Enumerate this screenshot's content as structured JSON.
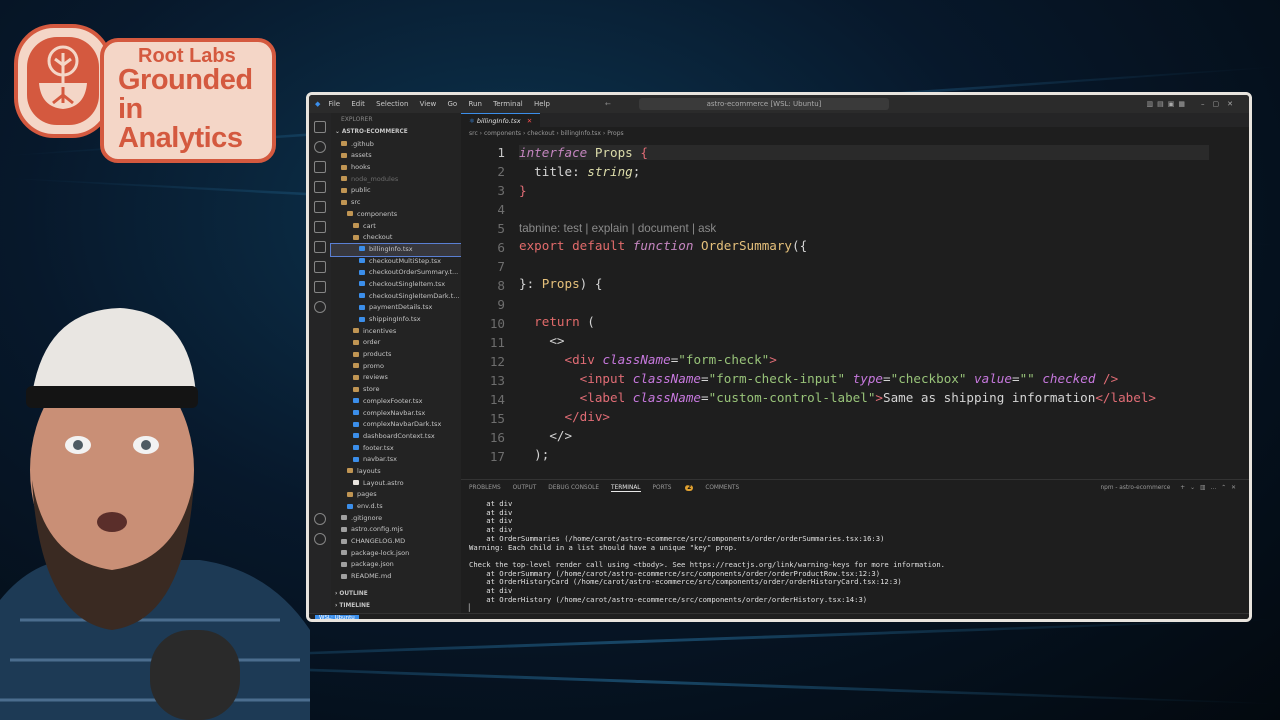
{
  "logo": {
    "line1": "Root Labs",
    "line2": "Grounded in",
    "line3": "Analytics"
  },
  "titlebar": {
    "menu": [
      "File",
      "Edit",
      "Selection",
      "View",
      "Go",
      "Run",
      "Terminal",
      "Help"
    ],
    "search": "astro-ecommerce [WSL: Ubuntu]"
  },
  "sidebar": {
    "header": "EXPLORER",
    "root": "ASTRO-ECOMMERCE",
    "items": [
      {
        "label": ".github",
        "kind": "folder",
        "depth": 1
      },
      {
        "label": "assets",
        "kind": "folder",
        "depth": 1
      },
      {
        "label": "hooks",
        "kind": "folder",
        "depth": 1
      },
      {
        "label": "node_modules",
        "kind": "folder",
        "depth": 1
      },
      {
        "label": "public",
        "kind": "folder",
        "depth": 1
      },
      {
        "label": "src",
        "kind": "folder",
        "depth": 1
      },
      {
        "label": "components",
        "kind": "folder",
        "depth": 2
      },
      {
        "label": "cart",
        "kind": "folder",
        "depth": 3
      },
      {
        "label": "checkout",
        "kind": "folder",
        "depth": 3
      },
      {
        "label": "billingInfo.tsx",
        "kind": "file",
        "depth": 4,
        "selected": true
      },
      {
        "label": "checkoutMultiStep.tsx",
        "kind": "file",
        "depth": 4
      },
      {
        "label": "checkoutOrderSummary.t...",
        "kind": "file",
        "depth": 4
      },
      {
        "label": "checkoutSingleItem.tsx",
        "kind": "file",
        "depth": 4
      },
      {
        "label": "checkoutSingleItemDark.t...",
        "kind": "file",
        "depth": 4
      },
      {
        "label": "paymentDetails.tsx",
        "kind": "file",
        "depth": 4
      },
      {
        "label": "shippingInfo.tsx",
        "kind": "file",
        "depth": 4
      },
      {
        "label": "incentives",
        "kind": "folder",
        "depth": 3
      },
      {
        "label": "order",
        "kind": "folder",
        "depth": 3
      },
      {
        "label": "products",
        "kind": "folder",
        "depth": 3
      },
      {
        "label": "promo",
        "kind": "folder",
        "depth": 3
      },
      {
        "label": "reviews",
        "kind": "folder",
        "depth": 3
      },
      {
        "label": "store",
        "kind": "folder",
        "depth": 3
      },
      {
        "label": "complexFooter.tsx",
        "kind": "file",
        "depth": 3
      },
      {
        "label": "complexNavbar.tsx",
        "kind": "file",
        "depth": 3
      },
      {
        "label": "complexNavbarDark.tsx",
        "kind": "file",
        "depth": 3
      },
      {
        "label": "dashboardContext.tsx",
        "kind": "file",
        "depth": 3
      },
      {
        "label": "footer.tsx",
        "kind": "file",
        "depth": 3
      },
      {
        "label": "navbar.tsx",
        "kind": "file",
        "depth": 3
      },
      {
        "label": "layouts",
        "kind": "folder",
        "depth": 2
      },
      {
        "label": "Layout.astro",
        "kind": "astro",
        "depth": 3
      },
      {
        "label": "pages",
        "kind": "folder",
        "depth": 2
      },
      {
        "label": "env.d.ts",
        "kind": "ts",
        "depth": 2
      },
      {
        "label": ".gitignore",
        "kind": "misc",
        "depth": 1
      },
      {
        "label": "astro.config.mjs",
        "kind": "misc",
        "depth": 1
      },
      {
        "label": "CHANGELOG.MD",
        "kind": "misc",
        "depth": 1
      },
      {
        "label": "package-lock.json",
        "kind": "misc",
        "depth": 1
      },
      {
        "label": "package.json",
        "kind": "misc",
        "depth": 1
      },
      {
        "label": "README.md",
        "kind": "misc",
        "depth": 1
      }
    ],
    "outline": "OUTLINE",
    "timeline": "TIMELINE"
  },
  "editor": {
    "tab": "billingInfo.tsx",
    "breadcrumb": [
      "src",
      "components",
      "checkout",
      "billingInfo.tsx",
      "Props"
    ],
    "hint": "tabnine: test | explain | document | ask",
    "line_numbers": [
      "1",
      "2",
      "3",
      "4",
      "5",
      "6",
      "7",
      "8",
      "9",
      "10",
      "11",
      "12",
      "13",
      "14",
      "15",
      "16",
      "17"
    ]
  },
  "panel": {
    "tabs": [
      "PROBLEMS",
      "OUTPUT",
      "DEBUG CONSOLE",
      "TERMINAL",
      "PORTS",
      "COMMENTS"
    ],
    "active_tab": "TERMINAL",
    "ports_badge": "2",
    "terminal_name": "npm - astro-ecommerce",
    "terminal_lines": [
      "    at div",
      "    at div",
      "    at div",
      "    at div",
      "    at OrderSummaries (/home/carot/astro-ecommerce/src/components/order/orderSummaries.tsx:16:3)",
      "Warning: Each child in a list should have a unique \"key\" prop.",
      "",
      "Check the top-level render call using <tbody>. See https://reactjs.org/link/warning-keys for more information.",
      "    at OrderSummary (/home/carot/astro-ecommerce/src/components/order/orderProductRow.tsx:12:3)",
      "    at OrderHistoryCard (/home/carot/astro-ecommerce/src/components/order/orderHistoryCard.tsx:12:3)",
      "    at div",
      "    at OrderHistory (/home/carot/astro-ecommerce/src/components/order/orderHistory.tsx:14:3)",
      "▏"
    ]
  },
  "status": {
    "remote": "WSL: Ubuntu"
  }
}
